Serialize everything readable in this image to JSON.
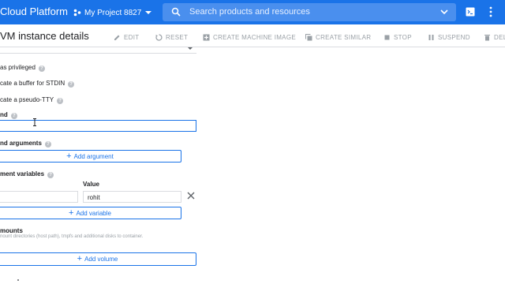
{
  "header": {
    "brand": "Cloud Platform",
    "project": "My Project 8827",
    "search_placeholder": "Search products and resources"
  },
  "actionbar": {
    "title": "VM instance details",
    "actions": [
      "EDIT",
      "RESET",
      "CREATE MACHINE IMAGE",
      "CREATE SIMILAR",
      "STOP",
      "SUSPEND",
      "DEL"
    ]
  },
  "form": {
    "privileged_label": "as privileged",
    "stdin_label": "cate a buffer for STDIN",
    "tty_label": "cate a pseudo-TTY",
    "command_label": "nd",
    "command_value": "",
    "args_label": "nd arguments",
    "add_argument": "Add argument",
    "env_label": "ment variables",
    "env_value_header": "Value",
    "env_name": "",
    "env_value": "rohit",
    "add_variable": "Add variable",
    "mounts_label": "mounts",
    "mounts_helper": "nount directories (host path), tmpfs and additional disks to container.",
    "add_volume": "Add volume"
  },
  "colors": {
    "topbar": "#1a73e8",
    "accent": "#1a73e8",
    "disabled_action": "#9aa0a6"
  },
  "icons": [
    "hexagon-icon",
    "search-icon",
    "chevron-down-icon",
    "cloud-shell-icon",
    "more-vert-icon",
    "pencil-icon",
    "reset-icon",
    "add-box-icon",
    "copy-icon",
    "stop-icon",
    "pause-icon",
    "trash-icon",
    "help-icon",
    "plus-icon",
    "close-icon",
    "text-cursor-icon"
  ]
}
